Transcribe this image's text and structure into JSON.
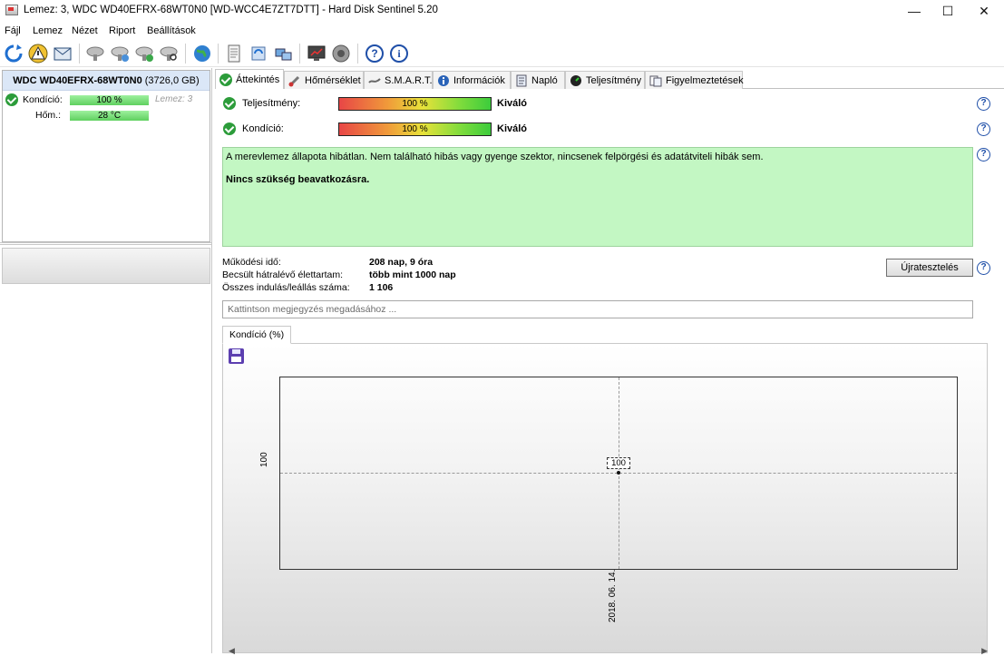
{
  "window": {
    "title": "Lemez: 3, WDC WD40EFRX-68WT0N0 [WD-WCC4E7ZT7DTT]  -  Hard Disk Sentinel 5.20",
    "controls": {
      "minimize": "—",
      "maximize": "☐",
      "close": "✕"
    }
  },
  "menu": {
    "items": [
      {
        "label": "Fájl"
      },
      {
        "label": "Lemez"
      },
      {
        "label": "Nézet"
      },
      {
        "label": "Riport"
      },
      {
        "label": "Beállítások"
      }
    ]
  },
  "toolbar": {
    "icons": [
      "refresh-icon",
      "alert-icon",
      "mail-icon",
      "disk-gray-icon",
      "disk-add-icon",
      "disk-check-icon",
      "disk-search-icon",
      "globe-icon",
      "document-icon",
      "sync-icon",
      "network-icon",
      "monitor-icon",
      "speaker-icon",
      "help-icon",
      "info-icon"
    ]
  },
  "disk": {
    "name": "WDC WD40EFRX-68WT0N0",
    "capacity": "(3726,0 GB)",
    "health_label": "Kondíció:",
    "health_value": "100 %",
    "health_fraction": 1.0,
    "disk_number": "Lemez: 3",
    "temp_label": "Hőm.:",
    "temp_value": "28 °C"
  },
  "tabs": [
    {
      "label": "Áttekintés",
      "icon": "check-icon"
    },
    {
      "label": "Hőmérséklet",
      "icon": "thermometer-icon"
    },
    {
      "label": "S.M.A.R.T.",
      "icon": "smart-icon"
    },
    {
      "label": "Információk",
      "icon": "info-icon"
    },
    {
      "label": "Napló",
      "icon": "log-icon"
    },
    {
      "label": "Teljesítmény",
      "icon": "performance-icon"
    },
    {
      "label": "Figyelmeztetések",
      "icon": "alerts-icon"
    }
  ],
  "overview": {
    "performance": {
      "label": "Teljesítmény:",
      "value": "100 %",
      "fraction": 1.0,
      "rating": "Kiváló"
    },
    "health": {
      "label": "Kondíció:",
      "value": "100 %",
      "fraction": 1.0,
      "rating": "Kiváló"
    },
    "status_text": "A merevlemez állapota hibátlan. Nem található hibás vagy gyenge szektor, nincsenek felpörgési és adatátviteli hibák sem.",
    "status_action": "Nincs szükség beavatkozásra.",
    "power_on_label": "Működési idő:",
    "power_on_value": "208 nap, 9 óra",
    "lifetime_label": "Becsült hátralévő élettartam:",
    "lifetime_value": "több mint 1000 nap",
    "startstop_label": "Összes indulás/leállás száma:",
    "startstop_value": "1 106",
    "reset_button": "Újratesztelés",
    "note_placeholder": "Kattintson megjegyzés megadásához ...",
    "graph_tab": "Kondíció  (%)"
  },
  "chart_data": {
    "type": "line",
    "x": [
      "2018. 06. 14."
    ],
    "series": [
      {
        "values": [
          100
        ]
      }
    ],
    "y_tick_labels": [
      "100"
    ],
    "x_tick_labels": [
      "2018. 06. 14."
    ],
    "data_labels": [
      "100"
    ],
    "grid": false
  }
}
